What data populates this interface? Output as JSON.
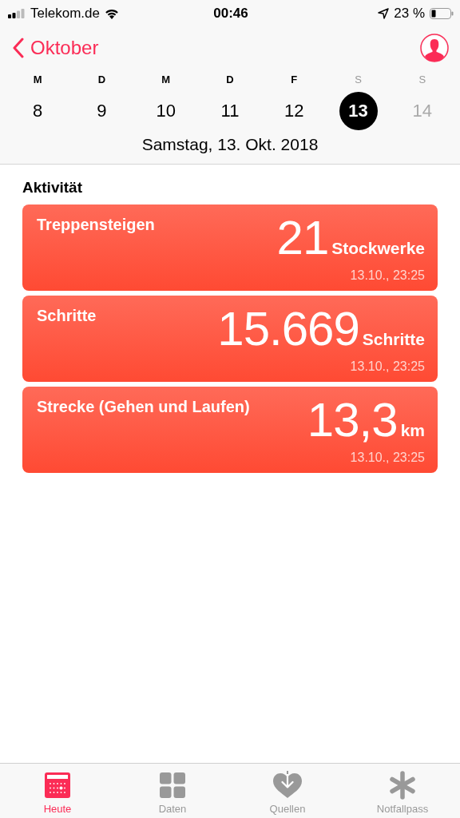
{
  "status_bar": {
    "carrier": "Telekom.de",
    "time": "00:46",
    "battery": "23 %"
  },
  "nav": {
    "back": "Oktober"
  },
  "week": [
    {
      "weekday": "M",
      "weekend": false,
      "day": "8",
      "selected": false,
      "future": false
    },
    {
      "weekday": "D",
      "weekend": false,
      "day": "9",
      "selected": false,
      "future": false
    },
    {
      "weekday": "M",
      "weekend": false,
      "day": "10",
      "selected": false,
      "future": false
    },
    {
      "weekday": "D",
      "weekend": false,
      "day": "11",
      "selected": false,
      "future": false
    },
    {
      "weekday": "F",
      "weekend": false,
      "day": "12",
      "selected": false,
      "future": false
    },
    {
      "weekday": "S",
      "weekend": true,
      "day": "13",
      "selected": true,
      "future": false
    },
    {
      "weekday": "S",
      "weekend": true,
      "day": "14",
      "selected": false,
      "future": true
    }
  ],
  "date_label": "Samstag, 13. Okt. 2018",
  "section_title": "Aktivität",
  "cards": [
    {
      "title": "Treppensteigen",
      "value": "21",
      "unit": "Stockwerke",
      "timestamp": "13.10., 23:25"
    },
    {
      "title": "Schritte",
      "value": "15.669",
      "unit": "Schritte",
      "timestamp": "13.10., 23:25"
    },
    {
      "title": "Strecke (Gehen und Laufen)",
      "value": "13,3",
      "unit": "km",
      "timestamp": "13.10., 23:25"
    }
  ],
  "tabs": [
    {
      "kind": "today",
      "label": "Heute",
      "selected": true
    },
    {
      "kind": "data",
      "label": "Daten",
      "selected": false
    },
    {
      "kind": "sources",
      "label": "Quellen",
      "selected": false
    },
    {
      "kind": "emergency",
      "label": "Notfallpass",
      "selected": false
    }
  ]
}
